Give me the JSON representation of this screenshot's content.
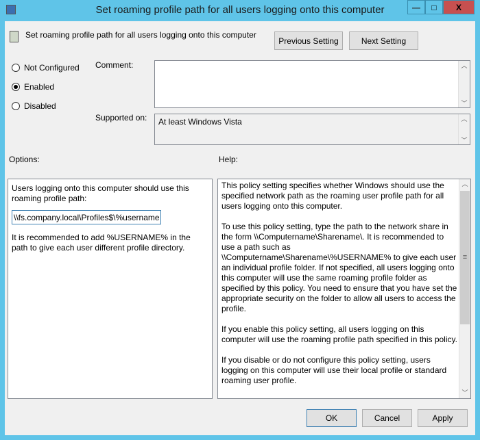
{
  "window": {
    "title": "Set roaming profile path for all users logging onto this computer",
    "minimize": "—",
    "maximize": "□",
    "close": "X"
  },
  "header": {
    "setting_name": "Set roaming profile path for all users logging onto this computer",
    "previous_label": "Previous Setting",
    "next_label": "Next Setting"
  },
  "state": {
    "options": [
      {
        "label": "Not Configured",
        "selected": false
      },
      {
        "label": "Enabled",
        "selected": true
      },
      {
        "label": "Disabled",
        "selected": false
      }
    ]
  },
  "comment": {
    "label": "Comment:",
    "value": ""
  },
  "supported": {
    "label": "Supported on:",
    "value": "At least Windows Vista"
  },
  "options_panel": {
    "label": "Options:",
    "prompt": "Users logging onto this computer should use this roaming profile path:",
    "path_value": "\\\\fs.company.local\\Profiles$\\%username%",
    "note": "It is recommended to add %USERNAME% in the path to give each user different profile directory."
  },
  "help_panel": {
    "label": "Help:",
    "paragraphs": [
      "This policy setting specifies whether Windows should use the specified network path as the roaming user profile path for all users logging onto this computer.",
      "To use this policy setting, type the path to the network share in the form \\\\Computername\\Sharename\\. It is recommended to use a path such as \\\\Computername\\Sharename\\%USERNAME% to give each user an individual profile folder. If not specified, all users logging onto this computer will use the same roaming profile folder as specified by this policy. You need to ensure that you have set the appropriate security on the folder to allow all users to access the profile.",
      "If you enable this policy setting, all users logging on this computer will use the roaming profile path specified in this policy.",
      "If you disable or do not configure this policy setting, users logging on this computer will use their local profile or standard roaming user profile."
    ]
  },
  "footer": {
    "ok": "OK",
    "cancel": "Cancel",
    "apply": "Apply"
  }
}
